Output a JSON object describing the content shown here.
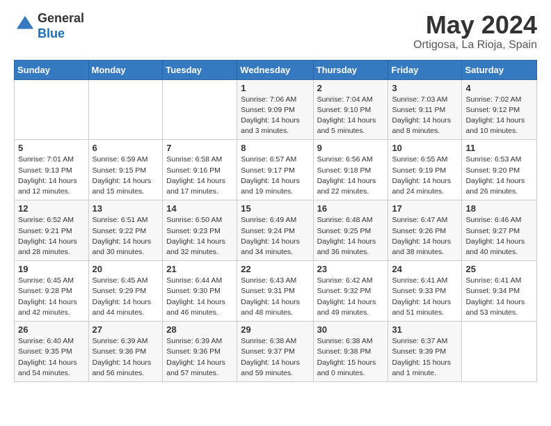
{
  "header": {
    "logo_general": "General",
    "logo_blue": "Blue",
    "month_title": "May 2024",
    "location": "Ortigosa, La Rioja, Spain"
  },
  "weekdays": [
    "Sunday",
    "Monday",
    "Tuesday",
    "Wednesday",
    "Thursday",
    "Friday",
    "Saturday"
  ],
  "weeks": [
    [
      {
        "day": "",
        "info": ""
      },
      {
        "day": "",
        "info": ""
      },
      {
        "day": "",
        "info": ""
      },
      {
        "day": "1",
        "info": "Sunrise: 7:06 AM\nSunset: 9:09 PM\nDaylight: 14 hours\nand 3 minutes."
      },
      {
        "day": "2",
        "info": "Sunrise: 7:04 AM\nSunset: 9:10 PM\nDaylight: 14 hours\nand 5 minutes."
      },
      {
        "day": "3",
        "info": "Sunrise: 7:03 AM\nSunset: 9:11 PM\nDaylight: 14 hours\nand 8 minutes."
      },
      {
        "day": "4",
        "info": "Sunrise: 7:02 AM\nSunset: 9:12 PM\nDaylight: 14 hours\nand 10 minutes."
      }
    ],
    [
      {
        "day": "5",
        "info": "Sunrise: 7:01 AM\nSunset: 9:13 PM\nDaylight: 14 hours\nand 12 minutes."
      },
      {
        "day": "6",
        "info": "Sunrise: 6:59 AM\nSunset: 9:15 PM\nDaylight: 14 hours\nand 15 minutes."
      },
      {
        "day": "7",
        "info": "Sunrise: 6:58 AM\nSunset: 9:16 PM\nDaylight: 14 hours\nand 17 minutes."
      },
      {
        "day": "8",
        "info": "Sunrise: 6:57 AM\nSunset: 9:17 PM\nDaylight: 14 hours\nand 19 minutes."
      },
      {
        "day": "9",
        "info": "Sunrise: 6:56 AM\nSunset: 9:18 PM\nDaylight: 14 hours\nand 22 minutes."
      },
      {
        "day": "10",
        "info": "Sunrise: 6:55 AM\nSunset: 9:19 PM\nDaylight: 14 hours\nand 24 minutes."
      },
      {
        "day": "11",
        "info": "Sunrise: 6:53 AM\nSunset: 9:20 PM\nDaylight: 14 hours\nand 26 minutes."
      }
    ],
    [
      {
        "day": "12",
        "info": "Sunrise: 6:52 AM\nSunset: 9:21 PM\nDaylight: 14 hours\nand 28 minutes."
      },
      {
        "day": "13",
        "info": "Sunrise: 6:51 AM\nSunset: 9:22 PM\nDaylight: 14 hours\nand 30 minutes."
      },
      {
        "day": "14",
        "info": "Sunrise: 6:50 AM\nSunset: 9:23 PM\nDaylight: 14 hours\nand 32 minutes."
      },
      {
        "day": "15",
        "info": "Sunrise: 6:49 AM\nSunset: 9:24 PM\nDaylight: 14 hours\nand 34 minutes."
      },
      {
        "day": "16",
        "info": "Sunrise: 6:48 AM\nSunset: 9:25 PM\nDaylight: 14 hours\nand 36 minutes."
      },
      {
        "day": "17",
        "info": "Sunrise: 6:47 AM\nSunset: 9:26 PM\nDaylight: 14 hours\nand 38 minutes."
      },
      {
        "day": "18",
        "info": "Sunrise: 6:46 AM\nSunset: 9:27 PM\nDaylight: 14 hours\nand 40 minutes."
      }
    ],
    [
      {
        "day": "19",
        "info": "Sunrise: 6:45 AM\nSunset: 9:28 PM\nDaylight: 14 hours\nand 42 minutes."
      },
      {
        "day": "20",
        "info": "Sunrise: 6:45 AM\nSunset: 9:29 PM\nDaylight: 14 hours\nand 44 minutes."
      },
      {
        "day": "21",
        "info": "Sunrise: 6:44 AM\nSunset: 9:30 PM\nDaylight: 14 hours\nand 46 minutes."
      },
      {
        "day": "22",
        "info": "Sunrise: 6:43 AM\nSunset: 9:31 PM\nDaylight: 14 hours\nand 48 minutes."
      },
      {
        "day": "23",
        "info": "Sunrise: 6:42 AM\nSunset: 9:32 PM\nDaylight: 14 hours\nand 49 minutes."
      },
      {
        "day": "24",
        "info": "Sunrise: 6:41 AM\nSunset: 9:33 PM\nDaylight: 14 hours\nand 51 minutes."
      },
      {
        "day": "25",
        "info": "Sunrise: 6:41 AM\nSunset: 9:34 PM\nDaylight: 14 hours\nand 53 minutes."
      }
    ],
    [
      {
        "day": "26",
        "info": "Sunrise: 6:40 AM\nSunset: 9:35 PM\nDaylight: 14 hours\nand 54 minutes."
      },
      {
        "day": "27",
        "info": "Sunrise: 6:39 AM\nSunset: 9:36 PM\nDaylight: 14 hours\nand 56 minutes."
      },
      {
        "day": "28",
        "info": "Sunrise: 6:39 AM\nSunset: 9:36 PM\nDaylight: 14 hours\nand 57 minutes."
      },
      {
        "day": "29",
        "info": "Sunrise: 6:38 AM\nSunset: 9:37 PM\nDaylight: 14 hours\nand 59 minutes."
      },
      {
        "day": "30",
        "info": "Sunrise: 6:38 AM\nSunset: 9:38 PM\nDaylight: 15 hours\nand 0 minutes."
      },
      {
        "day": "31",
        "info": "Sunrise: 6:37 AM\nSunset: 9:39 PM\nDaylight: 15 hours\nand 1 minute."
      },
      {
        "day": "",
        "info": ""
      }
    ]
  ]
}
